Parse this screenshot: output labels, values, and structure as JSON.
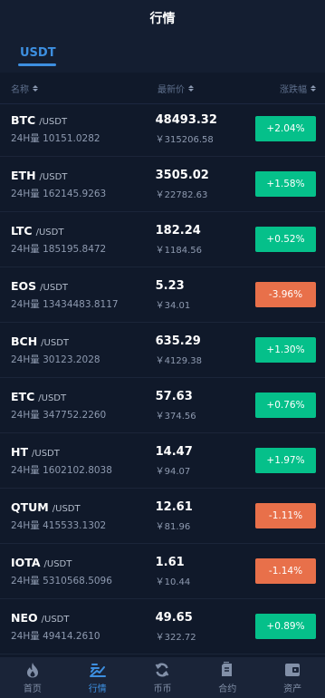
{
  "header": {
    "title": "行情"
  },
  "tabs": [
    {
      "label": "USDT",
      "active": true
    }
  ],
  "columns": {
    "name": "名称",
    "price": "最新价",
    "change": "涨跌幅"
  },
  "rows": [
    {
      "symbol": "BTC",
      "quote": "/USDT",
      "volume": "24H量 10151.0282",
      "price": "48493.32",
      "cny": "￥315206.58",
      "change": "+2.04%",
      "direction": "up"
    },
    {
      "symbol": "ETH",
      "quote": "/USDT",
      "volume": "24H量 162145.9263",
      "price": "3505.02",
      "cny": "￥22782.63",
      "change": "+1.58%",
      "direction": "up"
    },
    {
      "symbol": "LTC",
      "quote": "/USDT",
      "volume": "24H量 185195.8472",
      "price": "182.24",
      "cny": "￥1184.56",
      "change": "+0.52%",
      "direction": "up"
    },
    {
      "symbol": "EOS",
      "quote": "/USDT",
      "volume": "24H量 13434483.8117",
      "price": "5.23",
      "cny": "￥34.01",
      "change": "-3.96%",
      "direction": "down"
    },
    {
      "symbol": "BCH",
      "quote": "/USDT",
      "volume": "24H量 30123.2028",
      "price": "635.29",
      "cny": "￥4129.38",
      "change": "+1.30%",
      "direction": "up"
    },
    {
      "symbol": "ETC",
      "quote": "/USDT",
      "volume": "24H量 347752.2260",
      "price": "57.63",
      "cny": "￥374.56",
      "change": "+0.76%",
      "direction": "up"
    },
    {
      "symbol": "HT",
      "quote": "/USDT",
      "volume": "24H量 1602102.8038",
      "price": "14.47",
      "cny": "￥94.07",
      "change": "+1.97%",
      "direction": "up"
    },
    {
      "symbol": "QTUM",
      "quote": "/USDT",
      "volume": "24H量 415533.1302",
      "price": "12.61",
      "cny": "￥81.96",
      "change": "-1.11%",
      "direction": "down"
    },
    {
      "symbol": "IOTA",
      "quote": "/USDT",
      "volume": "24H量 5310568.5096",
      "price": "1.61",
      "cny": "￥10.44",
      "change": "-1.14%",
      "direction": "down"
    },
    {
      "symbol": "NEO",
      "quote": "/USDT",
      "volume": "24H量 49414.2610",
      "price": "49.65",
      "cny": "￥322.72",
      "change": "+0.89%",
      "direction": "up"
    }
  ],
  "tabbar": {
    "items": [
      {
        "label": "首页",
        "icon": "flame-icon"
      },
      {
        "label": "行情",
        "icon": "chart-lines-icon",
        "active": true
      },
      {
        "label": "币币",
        "icon": "exchange-icon"
      },
      {
        "label": "合约",
        "icon": "document-icon"
      },
      {
        "label": "资产",
        "icon": "wallet-icon"
      }
    ]
  },
  "colors": {
    "up": "#05c08a",
    "down": "#e8704a",
    "accent": "#3d8fe0",
    "background": "#10192a"
  }
}
